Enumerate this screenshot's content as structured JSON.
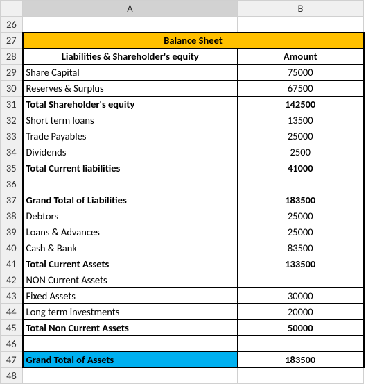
{
  "columns": {
    "rowhdr": "",
    "A": "A",
    "B": "B"
  },
  "title": "Balance Sheet",
  "header": {
    "label": "Liabilities & Shareholder's equity",
    "amount": "Amount"
  },
  "rows": [
    {
      "n": "26",
      "label": "",
      "amount": "",
      "style": "blank"
    },
    {
      "n": "27",
      "style": "title"
    },
    {
      "n": "28",
      "style": "header"
    },
    {
      "n": "29",
      "label": "Share Capital",
      "amount": "75000",
      "style": "data"
    },
    {
      "n": "30",
      "label": "Reserves & Surplus",
      "amount": "67500",
      "style": "data"
    },
    {
      "n": "31",
      "label": "Total Shareholder's equity",
      "amount": "142500",
      "style": "total"
    },
    {
      "n": "32",
      "label": "Short term loans",
      "amount": "13500",
      "style": "data"
    },
    {
      "n": "33",
      "label": "Trade Payables",
      "amount": "25000",
      "style": "data"
    },
    {
      "n": "34",
      "label": "Dividends",
      "amount": "2500",
      "style": "data"
    },
    {
      "n": "35",
      "label": "Total Current liabilities",
      "amount": "41000",
      "style": "total"
    },
    {
      "n": "36",
      "label": "",
      "amount": "",
      "style": "spacer"
    },
    {
      "n": "37",
      "label": "Grand Total of Liabilities",
      "amount": "183500",
      "style": "total"
    },
    {
      "n": "38",
      "label": "Debtors",
      "amount": "25000",
      "style": "data"
    },
    {
      "n": "39",
      "label": "Loans & Advances",
      "amount": "25000",
      "style": "data"
    },
    {
      "n": "40",
      "label": "Cash & Bank",
      "amount": "83500",
      "style": "data"
    },
    {
      "n": "41",
      "label": "Total Current Assets",
      "amount": "133500",
      "style": "total"
    },
    {
      "n": "42",
      "label": "NON Current Assets",
      "amount": "",
      "style": "data"
    },
    {
      "n": "43",
      "label": "Fixed Assets",
      "amount": "30000",
      "style": "data"
    },
    {
      "n": "44",
      "label": "Long term investments",
      "amount": "20000",
      "style": "data"
    },
    {
      "n": "45",
      "label": "Total Non Current Assets",
      "amount": "50000",
      "style": "total"
    },
    {
      "n": "46",
      "label": "",
      "amount": "",
      "style": "spacer"
    },
    {
      "n": "47",
      "label": "Grand Total of Assets",
      "amount": "183500",
      "style": "grand"
    },
    {
      "n": "48",
      "label": "",
      "amount": "",
      "style": "blank"
    }
  ]
}
